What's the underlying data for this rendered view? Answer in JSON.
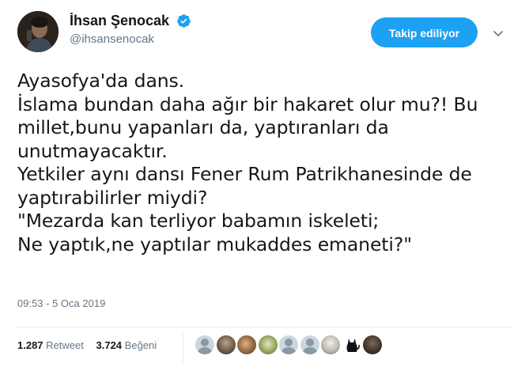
{
  "user": {
    "display_name": "İhsan Şenocak",
    "handle": "@ihsansenocak",
    "verified_icon": "verified-badge-icon",
    "avatar_icon": "profile-avatar"
  },
  "actions": {
    "follow_label": "Takip ediliyor",
    "menu_icon": "chevron-down-icon"
  },
  "tweet": {
    "text": "Ayasofya'da dans.\nİslama bundan daha ağır bir hakaret olur mu?! Bu millet,bunu yapanları da, yaptıranları da unutmayacaktır.\nYetkiler aynı dansı Fener Rum Patrikhanesinde de yaptırabilirler miydi?\n\"Mezarda kan terliyor babamın iskeleti;\nNe yaptık,ne yaptılar mukaddes emaneti?\"",
    "timestamp": "09:53 - 5 Oca 2019"
  },
  "stats": {
    "retweets_count": "1.287",
    "retweets_label": "Retweet",
    "likes_count": "3.724",
    "likes_label": "Beğeni"
  },
  "likers": [
    {
      "kind": "default"
    },
    {
      "kind": "photo1"
    },
    {
      "kind": "photo2"
    },
    {
      "kind": "photo3"
    },
    {
      "kind": "default"
    },
    {
      "kind": "default"
    },
    {
      "kind": "photo4"
    },
    {
      "kind": "cat"
    },
    {
      "kind": "photo5"
    }
  ],
  "colors": {
    "accent": "#1da1f2",
    "secondary_text": "#657786",
    "primary_text": "#14171a",
    "divider": "#e6ecf0"
  }
}
